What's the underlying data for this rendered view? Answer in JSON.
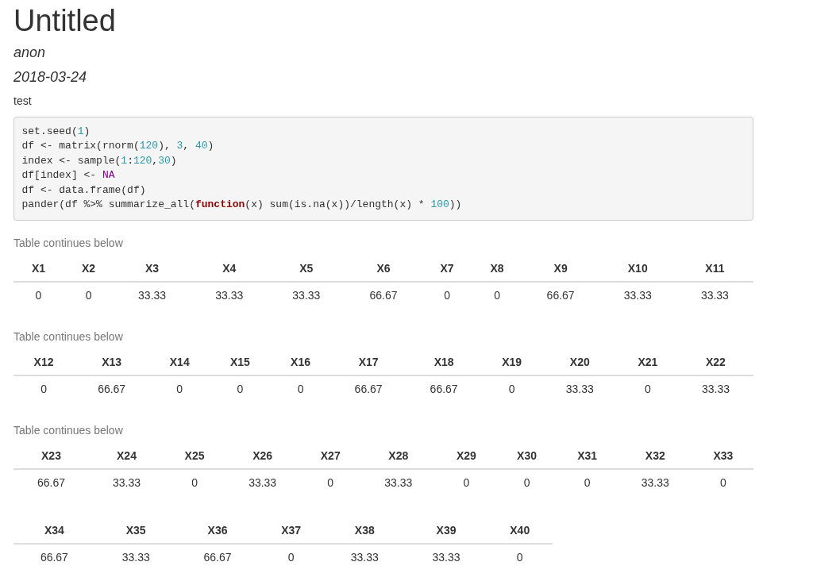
{
  "title": "Untitled",
  "author": "anon",
  "date": "2018-03-24",
  "paragraph": "test",
  "code_block": {
    "lines": [
      [
        {
          "kind": "plain",
          "text": "set.seed("
        },
        {
          "kind": "number",
          "text": "1"
        },
        {
          "kind": "plain",
          "text": ")"
        }
      ],
      [
        {
          "kind": "plain",
          "text": "df <- matrix(rnorm("
        },
        {
          "kind": "number",
          "text": "120"
        },
        {
          "kind": "plain",
          "text": "), "
        },
        {
          "kind": "number",
          "text": "3"
        },
        {
          "kind": "plain",
          "text": ", "
        },
        {
          "kind": "number",
          "text": "40"
        },
        {
          "kind": "plain",
          "text": ")"
        }
      ],
      [
        {
          "kind": "plain",
          "text": "index <- sample("
        },
        {
          "kind": "number",
          "text": "1"
        },
        {
          "kind": "plain",
          "text": ":"
        },
        {
          "kind": "number",
          "text": "120"
        },
        {
          "kind": "plain",
          "text": ","
        },
        {
          "kind": "number",
          "text": "30"
        },
        {
          "kind": "plain",
          "text": ")"
        }
      ],
      [
        {
          "kind": "plain",
          "text": "df[index] <- "
        },
        {
          "kind": "constant",
          "text": "NA"
        }
      ],
      [
        {
          "kind": "plain",
          "text": "df <- data.frame(df)"
        }
      ],
      [
        {
          "kind": "plain",
          "text": "pander(df %>% summarize_all("
        },
        {
          "kind": "keyword",
          "text": "function"
        },
        {
          "kind": "plain",
          "text": "(x) sum(is.na(x))/length(x) * "
        },
        {
          "kind": "number",
          "text": "100"
        },
        {
          "kind": "plain",
          "text": "))"
        }
      ]
    ]
  },
  "tables": [
    {
      "caption": "Table continues below",
      "columns": [
        "X1",
        "X2",
        "X3",
        "X4",
        "X5",
        "X6",
        "X7",
        "X8",
        "X9",
        "X10",
        "X11"
      ],
      "rows": [
        [
          "0",
          "0",
          "33.33",
          "33.33",
          "33.33",
          "66.67",
          "0",
          "0",
          "66.67",
          "33.33",
          "33.33"
        ]
      ]
    },
    {
      "caption": "Table continues below",
      "columns": [
        "X12",
        "X13",
        "X14",
        "X15",
        "X16",
        "X17",
        "X18",
        "X19",
        "X20",
        "X21",
        "X22"
      ],
      "rows": [
        [
          "0",
          "66.67",
          "0",
          "0",
          "0",
          "66.67",
          "66.67",
          "0",
          "33.33",
          "0",
          "33.33"
        ]
      ]
    },
    {
      "caption": "Table continues below",
      "columns": [
        "X23",
        "X24",
        "X25",
        "X26",
        "X27",
        "X28",
        "X29",
        "X30",
        "X31",
        "X32",
        "X33"
      ],
      "rows": [
        [
          "66.67",
          "33.33",
          "0",
          "33.33",
          "0",
          "33.33",
          "0",
          "0",
          "0",
          "33.33",
          "0"
        ]
      ]
    },
    {
      "columns": [
        "X34",
        "X35",
        "X36",
        "X37",
        "X38",
        "X39",
        "X40"
      ],
      "rows": [
        [
          "66.67",
          "33.33",
          "66.67",
          "0",
          "33.33",
          "33.33",
          "0"
        ]
      ]
    }
  ]
}
